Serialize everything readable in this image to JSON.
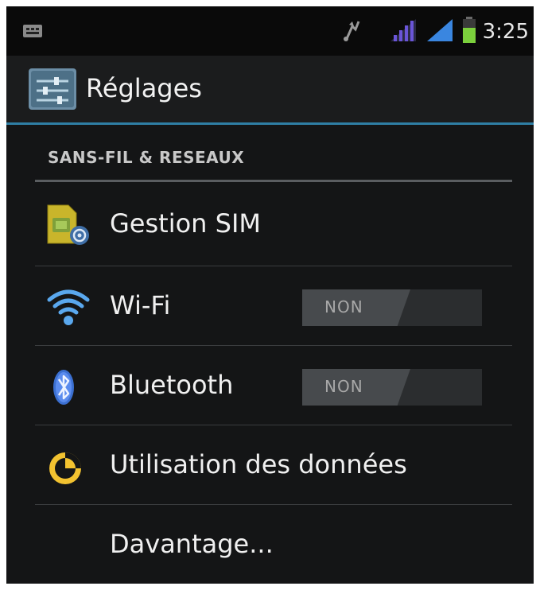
{
  "status_bar": {
    "time": "3:25",
    "icons": [
      "notification-icon",
      "usb-icon",
      "signal-1-icon",
      "signal-2-icon",
      "battery-icon"
    ]
  },
  "action_bar": {
    "title": "Réglages",
    "icon": "settings-app-icon"
  },
  "section": {
    "header": "SANS-FIL & RESEAUX"
  },
  "items": [
    {
      "label": "Gestion SIM",
      "icon": "sim-card-icon"
    },
    {
      "label": "Wi-Fi",
      "icon": "wifi-icon",
      "toggle": "NON"
    },
    {
      "label": "Bluetooth",
      "icon": "bluetooth-icon",
      "toggle": "NON"
    },
    {
      "label": "Utilisation des données",
      "icon": "data-usage-icon"
    },
    {
      "label": "Davantage..."
    }
  ],
  "colors": {
    "accent": "#2f7fa5",
    "background": "#141516",
    "signal_purple": "#6a55d8",
    "signal_blue": "#3a86e0",
    "battery_green": "#7bd03c"
  }
}
